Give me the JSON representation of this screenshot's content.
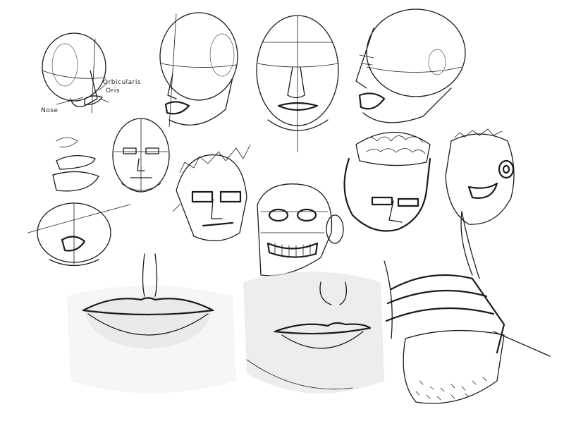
{
  "annotations": {
    "muscle_line1": "Orbicularis",
    "muscle_line2": "Oris",
    "nose": "Nose"
  },
  "colors": {
    "ink": "#1a1a1a",
    "paper": "#ffffff",
    "shade": "#cfcfcf"
  }
}
